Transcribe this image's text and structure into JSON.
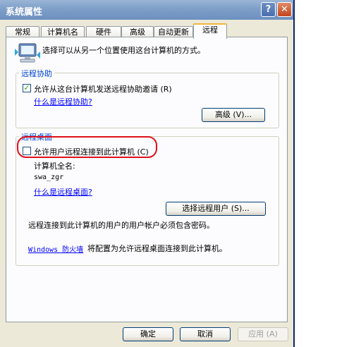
{
  "window": {
    "title": "系统属性",
    "help_glyph": "?",
    "close_glyph": "✕"
  },
  "tabs": [
    {
      "label": "常规"
    },
    {
      "label": "计算机名"
    },
    {
      "label": "硬件"
    },
    {
      "label": "高级"
    },
    {
      "label": "自动更新"
    },
    {
      "label": "远程"
    }
  ],
  "intro": {
    "text": "选择可以从另一个位置使用这台计算机的方式。"
  },
  "remote_assistance": {
    "group_label": "远程协助",
    "checkbox_label": "允许从这台计算机发送远程协助邀请 (R)",
    "checked": true,
    "check_glyph": "✓",
    "link": "什么是远程协助?",
    "advanced_button": "高级 (V)..."
  },
  "remote_desktop": {
    "group_label": "远程桌面",
    "checkbox_label": "允许用户远程连接到此计算机 (C)",
    "checked": false,
    "full_name_label": "计算机全名:",
    "computer_name": "swa_zgr",
    "link": "什么是远程桌面?",
    "select_users_button": "选择远程用户 (S)...",
    "note": "远程连接到此计算机的用户的用户帐户必须包含密码。",
    "firewall_link": "Windows 防火墙",
    "firewall_text": "将配置为允许远程桌面连接到此计算机。"
  },
  "footer": {
    "ok": "确定",
    "cancel": "取消",
    "apply": "应用 (A)"
  },
  "colors": {
    "title_bar": "#7d9fc8",
    "highlight_oval": "#e0101a",
    "group_label": "#0046d5",
    "link": "#0000ff"
  }
}
